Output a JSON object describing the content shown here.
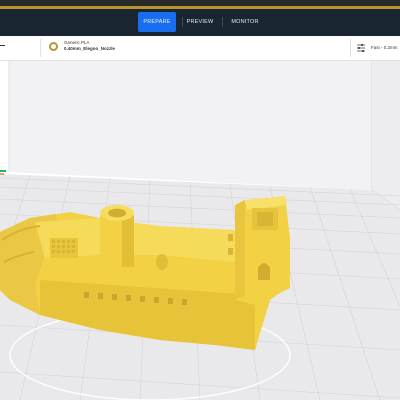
{
  "stage_menu": {
    "tabs": [
      {
        "label": "PREPARE",
        "active": true
      },
      {
        "label": "PREVIEW",
        "active": false
      },
      {
        "label": "MONITOR",
        "active": false
      }
    ]
  },
  "print_setup": {
    "material": "Generic PLA",
    "nozzle": "0.40mm_Elegoo_Nozzle",
    "profile": "Fast - 0.2mm"
  },
  "colors": {
    "header_dark": "#1a2532",
    "accent_blue": "#196ef0",
    "brand_gold": "#b8962e",
    "model_yellow": "#f2d144",
    "build_plate": "#e9e9ec",
    "grid_line": "#d4d4d8",
    "x_axis": "#d9403a",
    "y_axis": "#1dbd4b"
  },
  "icons": {
    "material": "material-spool-icon",
    "profile": "settings-sliders-icon",
    "nav_left": "chevron-left-icon"
  }
}
